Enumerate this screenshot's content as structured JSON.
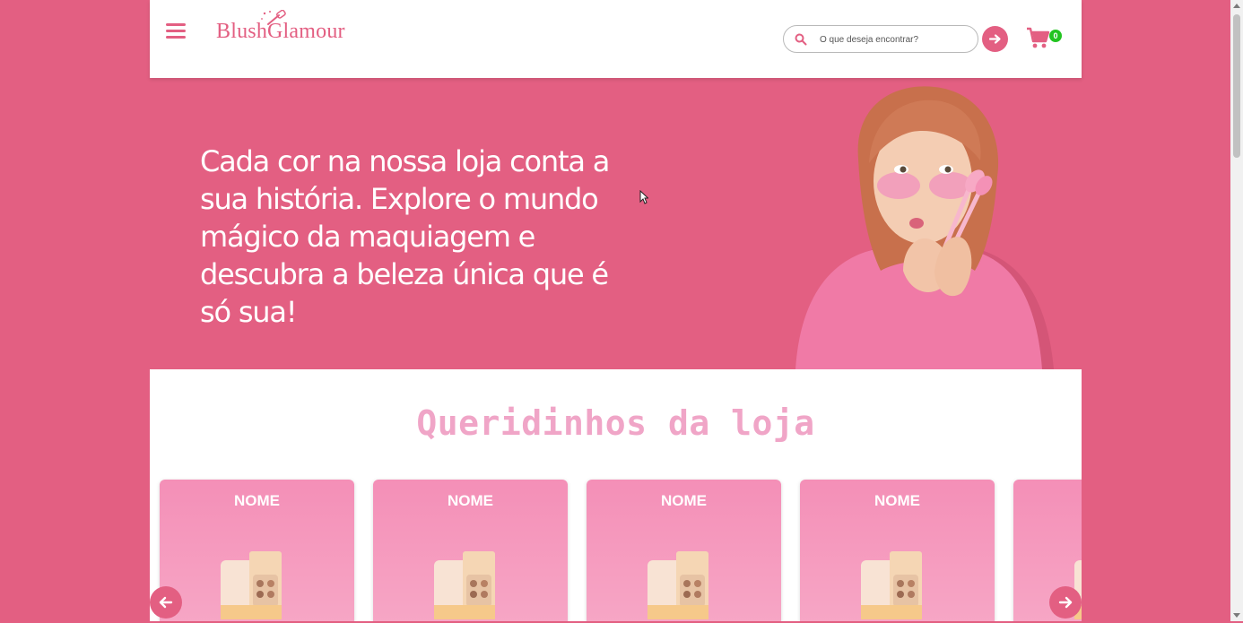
{
  "header": {
    "logo_text": "BlushGlamour",
    "search_placeholder": "O que deseja encontrar?",
    "cart_count": "0",
    "icons": {
      "menu": "hamburger-icon",
      "search": "search-icon",
      "search_submit": "arrow-right-icon",
      "cart": "cart-icon"
    }
  },
  "hero": {
    "headline": "Cada cor na nossa loja conta a sua história. Explore o mundo mágico da maquiagem e descubra a beleza única que é só sua!"
  },
  "products": {
    "title": "Queridinhos da loja",
    "cards": [
      {
        "name": "NOME"
      },
      {
        "name": "NOME"
      },
      {
        "name": "NOME"
      },
      {
        "name": "NOME"
      },
      {
        "name": ""
      }
    ]
  },
  "colors": {
    "brand_pink": "#e35f82",
    "title_pink": "#f0a5c7",
    "card_pink": "#f48fb7",
    "badge_green": "#22c421"
  }
}
